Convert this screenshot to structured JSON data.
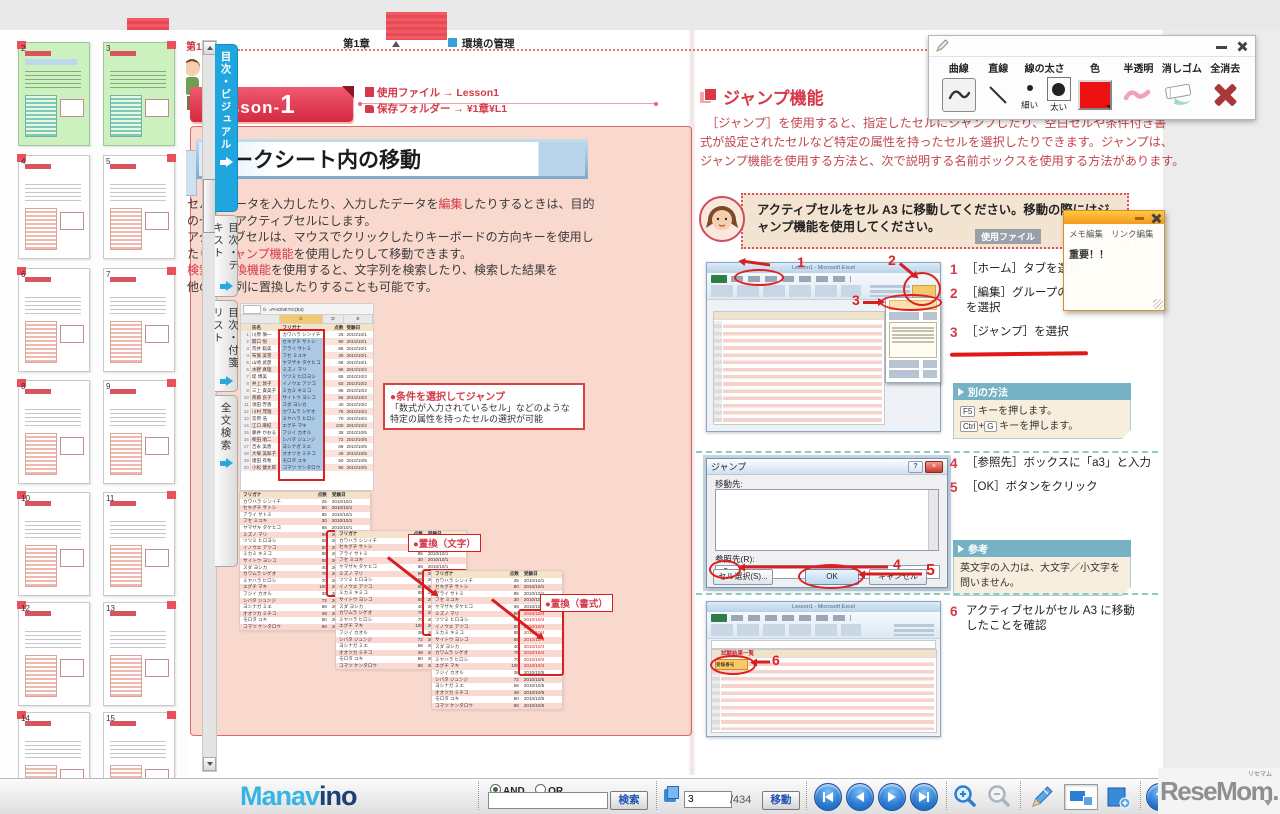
{
  "chrome": {
    "side_tabs": [
      {
        "label": "目次・ビジュアル",
        "active": true
      },
      {
        "label": "目次・テキスト",
        "active": false
      },
      {
        "label": "目次・付箋リスト",
        "active": false
      },
      {
        "label": "全文検索",
        "active": false
      }
    ],
    "thumbnails": {
      "pages": [
        2,
        3,
        4,
        5,
        6,
        7,
        8,
        9,
        10,
        11,
        12,
        13,
        14,
        15
      ],
      "current": [
        2,
        3
      ]
    },
    "pen_toolbar": {
      "curve": "曲線",
      "line": "直線",
      "thickness": "線の太さ",
      "thin": "細い",
      "thick": "太い",
      "color": "色",
      "color_value": "#ee1111",
      "translucent": "半透明",
      "eraser": "消しゴム",
      "clear": "全消去"
    },
    "memo": {
      "edit": "メモ編集",
      "link": "リンク編集",
      "body": "重要！！"
    },
    "toolbar": {
      "logo_a": "Manav",
      "logo_b": "ino",
      "and": "AND",
      "or": "OR",
      "search_value": "",
      "search_btn": "検索",
      "page_value": "3",
      "page_total": "/434",
      "go_btn": "移動"
    },
    "watermark": {
      "text": "ReseMom",
      "ruby": "リセマム",
      "dot": "."
    }
  },
  "doc": {
    "margin_chapter": "第1章",
    "header": {
      "chapter": "第1章",
      "section": "環境の管理"
    },
    "left": {
      "lesson_prefix": "Lesson-",
      "lesson_num": "1",
      "file_label": "使用ファイル",
      "arrow": "→",
      "file_value": "Lesson1",
      "folder_label": "保存フォルダー",
      "folder_value": "¥1章¥L1",
      "title": "ワークシート内の移動",
      "body_lines": [
        "セルにデータを入力したり、入力したデータを編集したりするときは、目的",
        "のセルをアクティブセルにします。",
        "アクティブセルは、マウスでクリックしたりキーボードの方向キーを使用し",
        "たり、ジャンプ機能を使用したりして移動できます。",
        "検索や置換機能を使用すると、文字列を検索したり、検索した結果を",
        "他の文字列に置換したりすることも可能です。"
      ],
      "red_keywords": [
        "編集",
        "ジャンプ機能",
        "検索や置換機能"
      ],
      "excel": {
        "fx": "fx",
        "formula": "=PHONETIC(B4)",
        "col_letters": [
          "C",
          "D",
          "E"
        ],
        "sheet_headers": [
          "氏名",
          "フリガナ",
          "点数",
          "受験日"
        ],
        "names_kanji": [
          "川原 慎一",
          "関口 悟",
          "荒井 聡美",
          "布施 美雪",
          "山崎 武彦",
          "水野 真理",
          "堤 博美",
          "井上 敦子",
          "三上 貴美子",
          "斎藤 良子",
          "須田 芳香",
          "川村 茂雄",
          "宮原 浩",
          "江口 麻紀",
          "藤井 かおる",
          "柴田 順二",
          "吉永 美恵",
          "大塚 美知子",
          "諸田 有希",
          "小松 健太郎"
        ],
        "rows": [
          [
            "カワハラ シンイチ",
            "25",
            "2010/10/1"
          ],
          [
            "セキグチ サトシ",
            "80",
            "2010/10/1"
          ],
          [
            "アライ サトミ",
            "85",
            "2010/10/1"
          ],
          [
            "フセ ミユキ",
            "30",
            "2010/10/1"
          ],
          [
            "ヤマザキ タケヒコ",
            "68",
            "2010/10/1"
          ],
          [
            "ミズノ マリ",
            "96",
            "2010/10/2"
          ],
          [
            "ツツミ ヒロヨシ",
            "65",
            "2010/10/2"
          ],
          [
            "イノウエ アツコ",
            "60",
            "2010/10/2"
          ],
          [
            "ミカミ キミコ",
            "85",
            "2010/10/2"
          ],
          [
            "サイトウ ヨシコ",
            "55",
            "2010/10/2"
          ],
          [
            "スダ ヨシカ",
            "40",
            "2010/10/2"
          ],
          [
            "カワムラ シゲオ",
            "76",
            "2010/10/2"
          ],
          [
            "ミヤハラ ヒロシ",
            "70",
            "2010/10/2"
          ],
          [
            "エグチ マキ",
            "100",
            "2010/10/2"
          ],
          [
            "フジイ カオル",
            "38",
            "2010/10/5"
          ],
          [
            "シバタ ジュンジ",
            "72",
            "2010/10/5"
          ],
          [
            "ヨシナガ ミエ",
            "68",
            "2010/10/5"
          ],
          [
            "オオツカ ミチコ",
            "49",
            "2010/10/5"
          ],
          [
            "モロタ ユキ",
            "50",
            "2010/10/5"
          ],
          [
            "コマツ ケンタロウ",
            "90",
            "2010/10/5"
          ]
        ]
      },
      "jump_note_title": "●条件を選択してジャンプ",
      "jump_note_body": "「数式が入力されているセル」などのような特定の属性を持ったセルの選択が可能",
      "replace_char": "●置換（文字）",
      "replace_format": "●置換（書式）",
      "mini_headers": [
        "フリガナ",
        "点数",
        "受験日"
      ],
      "replaced_date": "2010/10/4"
    },
    "right": {
      "section": "ジャンプ機能",
      "para_lines": [
        "　［ジャンプ］を使用すると、指定したセルにジャンプしたり、空白セルや条件付き書",
        "式が設定されたセルなど特定の属性を持ったセルを選択したりできます。ジャンプは、",
        "ジャンプ機能を使用する方法と、次で説明する名前ボックスを使用する方法があります。"
      ],
      "task_text": "アクティブセルをセル A3 に移動してください。移動の際にはジャンプ機能を使用してください。",
      "task_badge": "使用ファイル",
      "excel_window_title": "Lesson1 - Microsoft Excel",
      "sheet_title": "試験結果一覧",
      "cell_value": "受験番号",
      "steps": [
        {
          "n": "1",
          "lines": [
            "［ホーム］タブを選択"
          ]
        },
        {
          "n": "2",
          "lines": [
            "［編集］グループの",
            "を選択"
          ]
        },
        {
          "n": "3",
          "lines": [
            "［ジャンプ］を選択"
          ]
        },
        {
          "n": "4",
          "lines": [
            "［参照先］ボックスに「a3」と入力"
          ]
        },
        {
          "n": "5",
          "lines": [
            "［OK］ボタンをクリック"
          ]
        },
        {
          "n": "6",
          "lines": [
            "アクティブセルがセル A3 に移動",
            "したことを確認"
          ]
        }
      ],
      "alt_box": {
        "title": "別の方法",
        "rows": [
          {
            "keys": [
              "F5"
            ],
            "text": "キーを押します。"
          },
          {
            "keys": [
              "Ctrl",
              "G"
            ],
            "text": "キーを押します。"
          }
        ]
      },
      "ref_box": {
        "title": "参考",
        "text": "英文字の入力は、大文字／小文字を問いません。"
      },
      "dialog": {
        "title": "ジャンプ",
        "help_glyph": "?",
        "close_glyph": "×",
        "dest_label": "移動先:",
        "ref_label": "参照先(R):",
        "ref_value": "a3",
        "cells_btn": "セル選択(S)...",
        "ok_btn": "OK",
        "cancel_btn": "キャンセル"
      }
    }
  }
}
